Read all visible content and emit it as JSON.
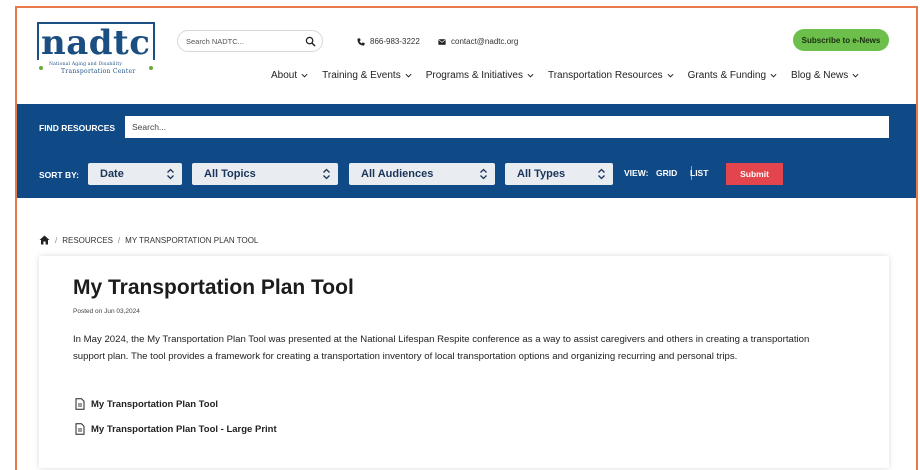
{
  "brand": {
    "logo_text_main": "nadtc",
    "logo_line1": "National Aging and Disability",
    "logo_line2": "Transportation Center"
  },
  "header": {
    "search_placeholder": "Search NADTC...",
    "phone": "866-983-3222",
    "email": "contact@nadtc.org",
    "subscribe_label": "Subscribe to e-News"
  },
  "nav": {
    "items": [
      {
        "label": "About"
      },
      {
        "label": "Training & Events"
      },
      {
        "label": "Programs & Initiatives"
      },
      {
        "label": "Transportation Resources"
      },
      {
        "label": "Grants & Funding"
      },
      {
        "label": "Blog & News"
      }
    ]
  },
  "filters": {
    "find_label": "FIND RESOURCES",
    "search_placeholder": "Search...",
    "sort_label": "SORT BY:",
    "sort_value": "Date",
    "topics_value": "All Topics",
    "audiences_value": "All Audiences",
    "types_value": "All Types",
    "view_label": "VIEW:",
    "view_grid": "GRID",
    "view_list": "LIST",
    "submit_label": "Submit"
  },
  "breadcrumb": {
    "items": [
      "RESOURCES",
      "MY TRANSPORTATION PLAN TOOL"
    ]
  },
  "article": {
    "title": "My Transportation Plan Tool",
    "posted": "Posted on Jun 03,2024",
    "description": "In May 2024, the My Transportation Plan Tool was presented at the National Lifespan Respite conference as a way to assist caregivers and others in creating a transportation support plan. The tool provides a framework for creating a transportation inventory of local transportation options and organizing recurring and personal trips.",
    "files": [
      {
        "label": "My Transportation Plan Tool"
      },
      {
        "label": "My Transportation Plan Tool - Large Print"
      }
    ]
  },
  "colors": {
    "frame": "#e8794a",
    "navy": "#0f4a87",
    "green": "#6cbf4a",
    "submit": "#e2454c"
  }
}
